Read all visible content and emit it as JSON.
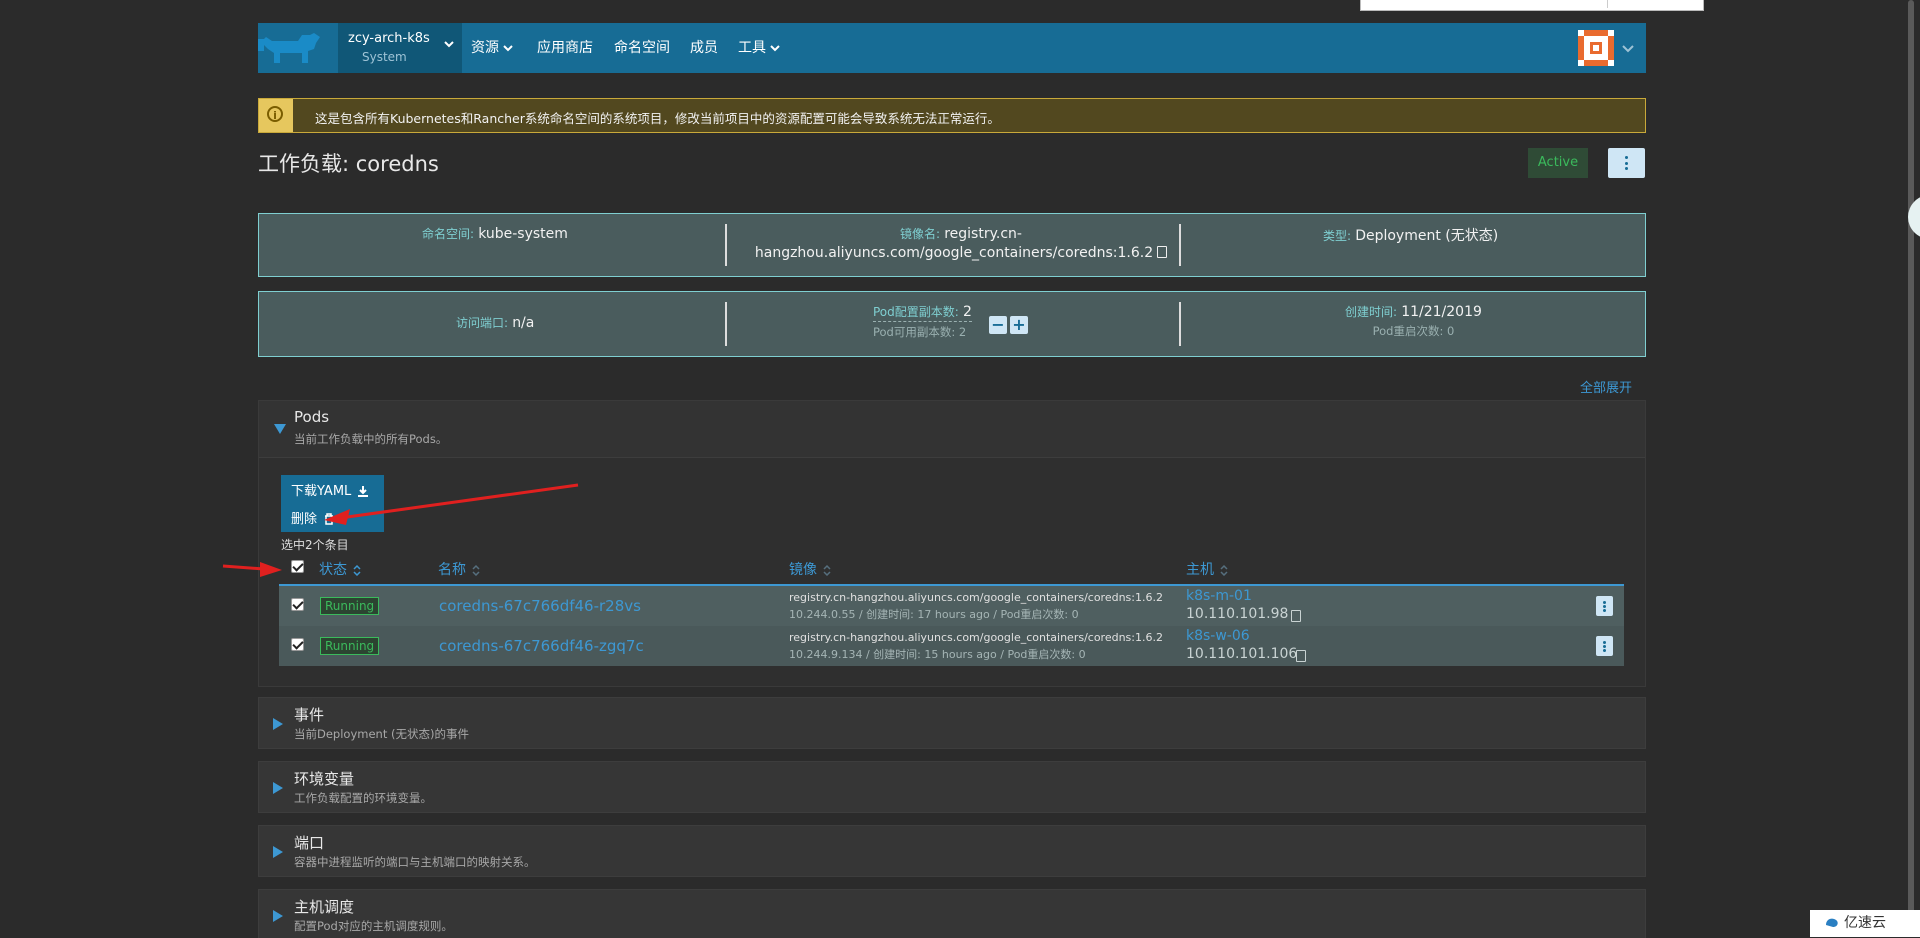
{
  "header": {
    "cluster_name": "zcy-arch-k8s",
    "project_name": "System",
    "nav": [
      {
        "label": "资源",
        "dropdown": true
      },
      {
        "label": "应用商店",
        "dropdown": false
      },
      {
        "label": "命名空间",
        "dropdown": false
      },
      {
        "label": "成员",
        "dropdown": false
      },
      {
        "label": "工具",
        "dropdown": true
      }
    ]
  },
  "banner": {
    "icon": "info-icon",
    "text": "这是包含所有Kubernetes和Rancher系统命名空间的系统项目，修改当前项目中的资源配置可能会导致系统无法正常运行。"
  },
  "page": {
    "title": "工作负载: coredns",
    "state": "Active"
  },
  "info": {
    "namespace_label": "命名空间:",
    "namespace_value": "kube-system",
    "image_label": "镜像名:",
    "image_value_line1": "registry.cn-",
    "image_value_line2": "hangzhou.aliyuncs.com/google_containers/coredns:1.6.2",
    "type_label": "类型:",
    "type_value": "Deployment (无状态)",
    "endpoint_label": "访问端口:",
    "endpoint_value": "n/a",
    "replicas_label": "Pod配置副本数:",
    "replicas_value": "2",
    "available_label": "Pod可用副本数: 2",
    "created_label": "创建时间:",
    "created_value": "11/21/2019",
    "restarts_label": "Pod重启次数: 0"
  },
  "expand_all": "全部展开",
  "pods": {
    "title": "Pods",
    "subtitle": "当前工作负载中的所有Pods。",
    "actions": {
      "download_yaml": "下载YAML",
      "delete": "删除"
    },
    "selected_text": "选中2个条目",
    "columns": {
      "state": "状态",
      "name": "名称",
      "image": "镜像",
      "host": "主机"
    },
    "rows": [
      {
        "state": "Running",
        "name": "coredns-67c766df46-r28vs",
        "image": "registry.cn-hangzhou.aliyuncs.com/google_containers/coredns:1.6.2",
        "image_detail": "10.244.0.55 / 创建时间: 17 hours ago / Pod重启次数: 0",
        "host_name": "k8s-m-01",
        "host_ip": "10.110.101.98"
      },
      {
        "state": "Running",
        "name": "coredns-67c766df46-zgq7c",
        "image": "registry.cn-hangzhou.aliyuncs.com/google_containers/coredns:1.6.2",
        "image_detail": "10.244.9.134 / 创建时间: 15 hours ago / Pod重启次数: 0",
        "host_name": "k8s-w-06",
        "host_ip": "10.110.101.106"
      }
    ]
  },
  "sections": [
    {
      "title": "事件",
      "subtitle": "当前Deployment (无状态)的事件"
    },
    {
      "title": "环境变量",
      "subtitle": "工作负载配置的环境变量。"
    },
    {
      "title": "端口",
      "subtitle": "容器中进程监听的端口与主机端口的映射关系。"
    },
    {
      "title": "主机调度",
      "subtitle": "配置Pod对应的主机调度规则。"
    }
  ],
  "watermark": "亿速云",
  "colors": {
    "background": "#2b2b2b",
    "header": "#176c95",
    "accent": "#3d98d3",
    "info_border": "#7fcfd1",
    "running_green": "#3bba5c",
    "annotation_red": "#e0201f"
  }
}
